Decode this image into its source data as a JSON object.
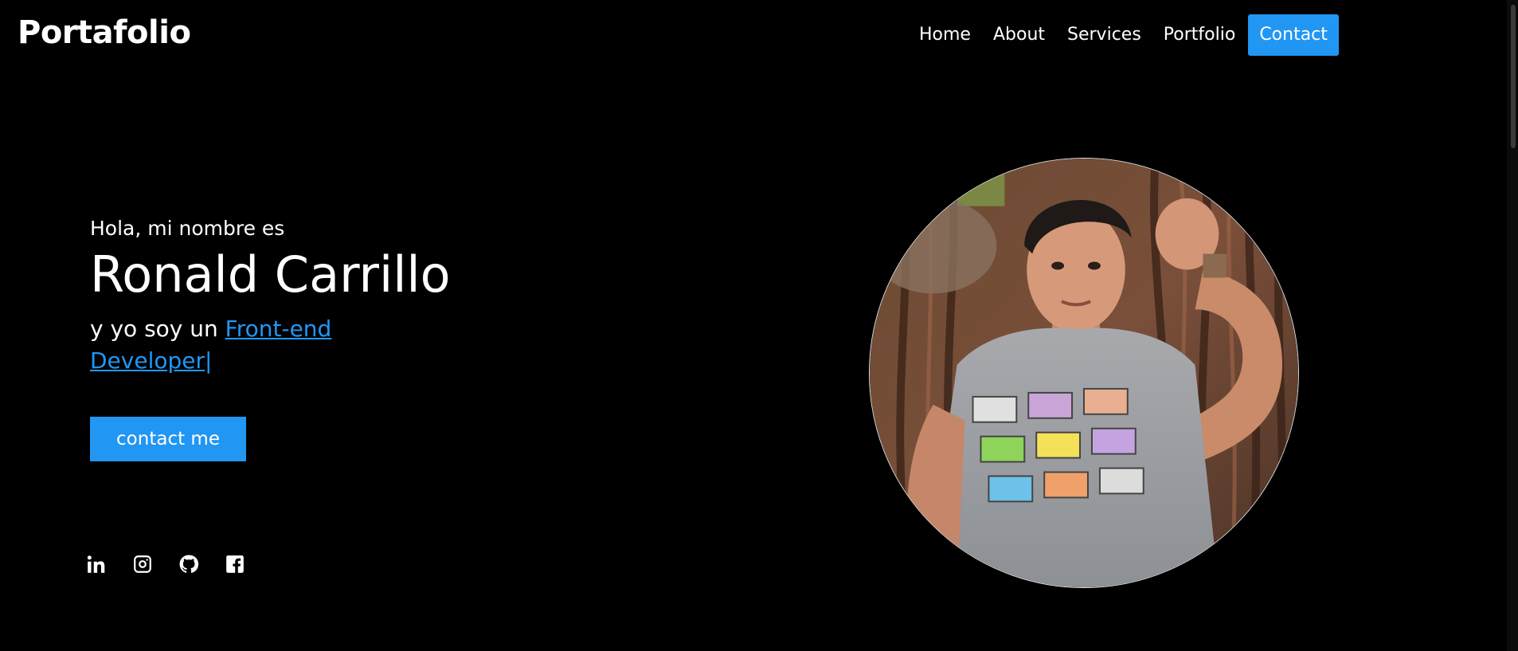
{
  "brand": "Portafolio",
  "nav": {
    "items": [
      {
        "label": "Home"
      },
      {
        "label": "About"
      },
      {
        "label": "Services"
      },
      {
        "label": "Portfolio"
      },
      {
        "label": "Contact"
      }
    ],
    "active_color": "#2196f3"
  },
  "hero": {
    "greeting": "Hola, mi nombre es",
    "name": "Ronald Carrillo",
    "role_prefix": "y yo soy un ",
    "role_typed": " Front-end Developer",
    "cursor": "|",
    "cta_label": "contact me"
  },
  "socials": [
    {
      "icon": "linkedin-icon"
    },
    {
      "icon": "instagram-icon"
    },
    {
      "icon": "github-icon"
    },
    {
      "icon": "facebook-icon"
    }
  ],
  "colors": {
    "background": "#000000",
    "accent": "#2196f3",
    "text": "#ffffff"
  }
}
